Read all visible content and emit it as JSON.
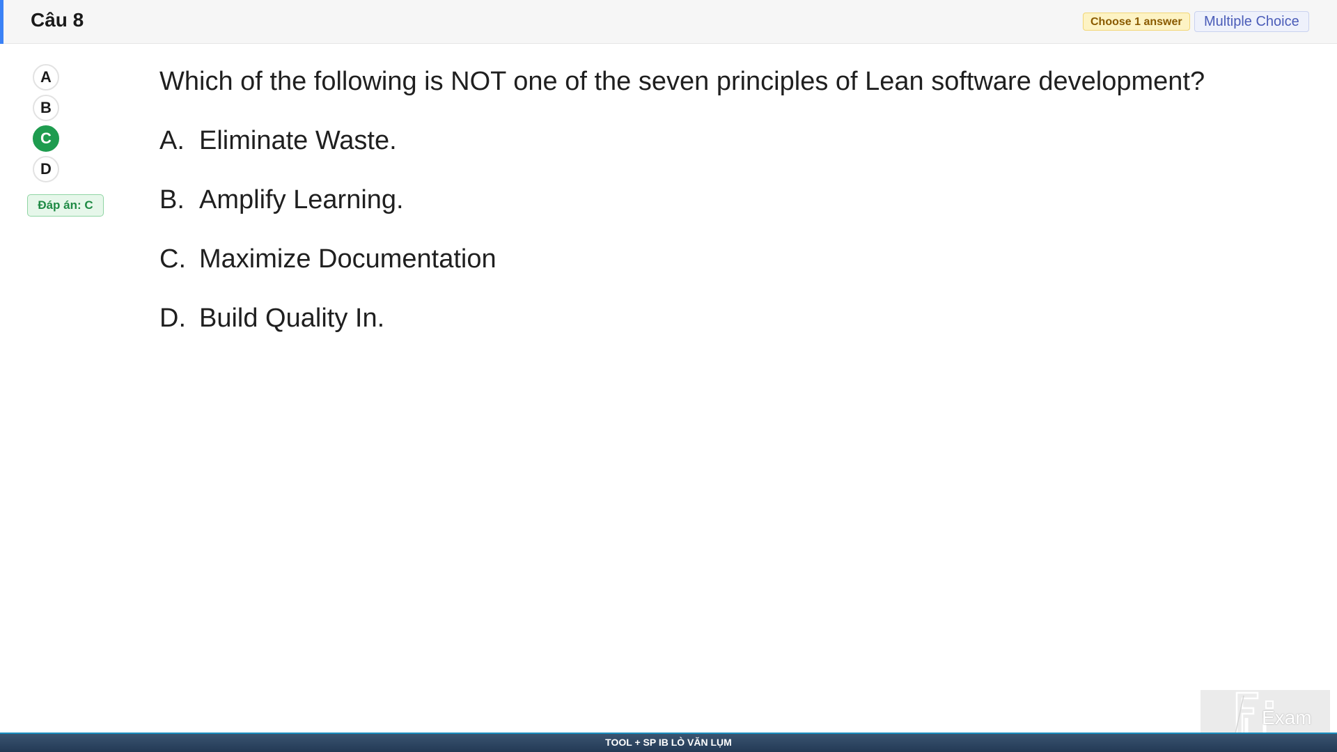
{
  "header": {
    "title": "Câu 8",
    "choose_badge": "Choose 1 answer",
    "type_badge": "Multiple Choice",
    "accent_color": "#3b82f6"
  },
  "answer_selector": {
    "options": [
      "A",
      "B",
      "C",
      "D"
    ],
    "selected": "C",
    "selected_color": "#1e9c4f",
    "answer_label": "Đáp án: C"
  },
  "question": {
    "text": "Which of the following is NOT one of the seven principles of Lean software development?",
    "choices": [
      {
        "letter": "A.",
        "text": "Eliminate Waste."
      },
      {
        "letter": "B.",
        "text": "Amplify Learning."
      },
      {
        "letter": "C.",
        "text": "Maximize Documentation"
      },
      {
        "letter": "D.",
        "text": "Build Quality In."
      }
    ]
  },
  "footer": {
    "text": "TOOL + SP IB LÒ VĂN LỤM"
  },
  "logo": {
    "text": "Exam",
    "icon": "fu-logo-icon"
  }
}
